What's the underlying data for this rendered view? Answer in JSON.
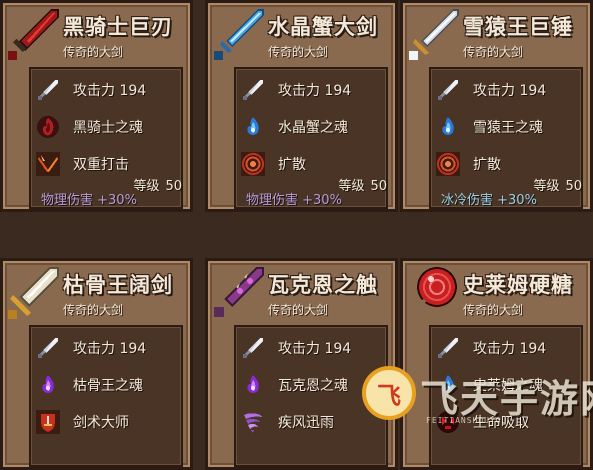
{
  "cards": [
    {
      "name": "黑骑士巨刃",
      "rarity": "传奇的大剑",
      "rows": [
        {
          "icon": "sword-icon",
          "text": "攻击力 194"
        },
        {
          "icon": "dark-soul-icon",
          "text": "黑骑士之魂"
        },
        {
          "icon": "double-strike-icon",
          "text": "双重打击"
        }
      ],
      "stat": "物理伤害 +30%",
      "stat_type": "physical",
      "level_label": "等级",
      "level": "50",
      "weapon": "black-greatsword-icon"
    },
    {
      "name": "水晶蟹大剑",
      "rarity": "传奇的大剑",
      "rows": [
        {
          "icon": "sword-icon",
          "text": "攻击力 194"
        },
        {
          "icon": "blue-soul-icon",
          "text": "水晶蟹之魂"
        },
        {
          "icon": "spread-icon",
          "text": "扩散"
        }
      ],
      "stat": "物理伤害 +30%",
      "stat_type": "physical",
      "level_label": "等级",
      "level": "50",
      "weapon": "crystal-greatsword-icon"
    },
    {
      "name": "雪猿王巨锤",
      "rarity": "传奇的大剑",
      "rows": [
        {
          "icon": "sword-icon",
          "text": "攻击力 194"
        },
        {
          "icon": "blue-soul-icon",
          "text": "雪猿王之魂"
        },
        {
          "icon": "spread-icon",
          "text": "扩散"
        }
      ],
      "stat": "冰冷伤害 +30%",
      "stat_type": "cold",
      "level_label": "等级",
      "level": "50",
      "weapon": "snow-greatsword-icon"
    },
    {
      "name": "枯骨王阔剑",
      "rarity": "传奇的大剑",
      "rows": [
        {
          "icon": "sword-icon",
          "text": "攻击力 194"
        },
        {
          "icon": "purple-soul-icon",
          "text": "枯骨王之魂"
        },
        {
          "icon": "sword-master-icon",
          "text": "剑术大师"
        }
      ],
      "weapon": "bone-broadsword-icon"
    },
    {
      "name": "瓦克恩之触",
      "rarity": "传奇的大剑",
      "rows": [
        {
          "icon": "sword-icon",
          "text": "攻击力 194"
        },
        {
          "icon": "purple-soul-icon",
          "text": "瓦克恩之魂"
        },
        {
          "icon": "whirlwind-icon",
          "text": "疾风迅雨"
        }
      ],
      "weapon": "thorn-blade-icon"
    },
    {
      "name": "史莱姆硬糖",
      "rarity": "传奇的大剑",
      "rows": [
        {
          "icon": "sword-icon",
          "text": "攻击力 194"
        },
        {
          "icon": "blue-soul-icon",
          "text": "史莱姆之魂"
        },
        {
          "icon": "life-steal-icon",
          "text": "生命吸取"
        }
      ],
      "weapon": "lollipop-icon"
    }
  ],
  "watermark": {
    "logo": "飞",
    "text": "飞天手游网",
    "sub": "FEITIANSHOUYOU"
  },
  "colors": {
    "card_bg": "#8a6a4e",
    "panel_bg": "#4a3426",
    "text": "#f4e9d8",
    "physical_stat": "#b89cd8",
    "cold_stat": "#9ad0e8"
  }
}
